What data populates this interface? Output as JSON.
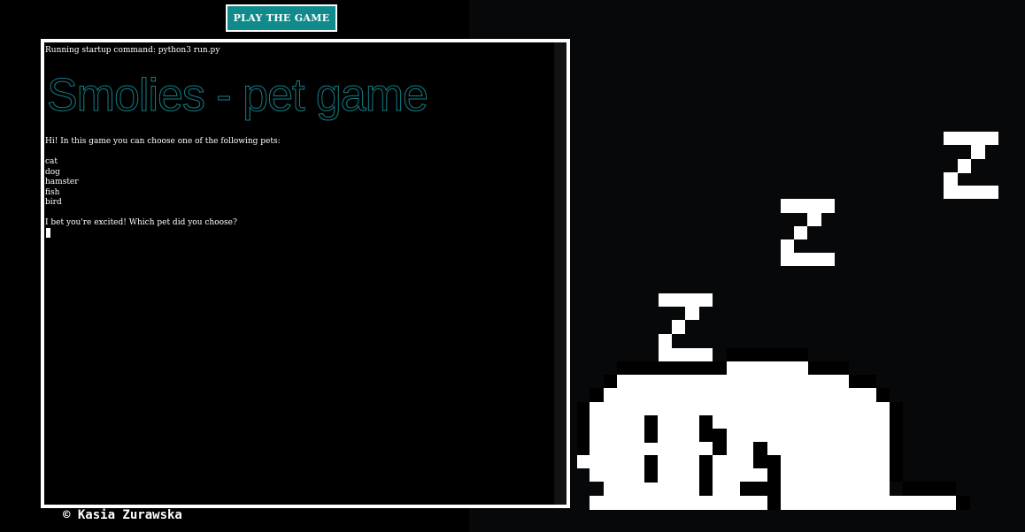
{
  "header": {
    "play_button_label": "PLAY THE GAME"
  },
  "terminal": {
    "startup_line": "Running startup command: python3 run.py",
    "banner": "Smolies - pet game",
    "intro": "Hi! In this game you can choose one of the following pets:",
    "pets": [
      "cat",
      "dog",
      "hamster",
      "fish",
      "bird"
    ],
    "prompt": "I bet you're excited! Which pet did you choose?"
  },
  "footer": {
    "copyright": "© Kasia Zurawska"
  },
  "colors": {
    "accent": "#108a8a",
    "banner_stroke": "#147f86",
    "background": "#000000",
    "panel": "#07080a"
  },
  "illustration": {
    "icon": "sleeping-pet-icon"
  }
}
